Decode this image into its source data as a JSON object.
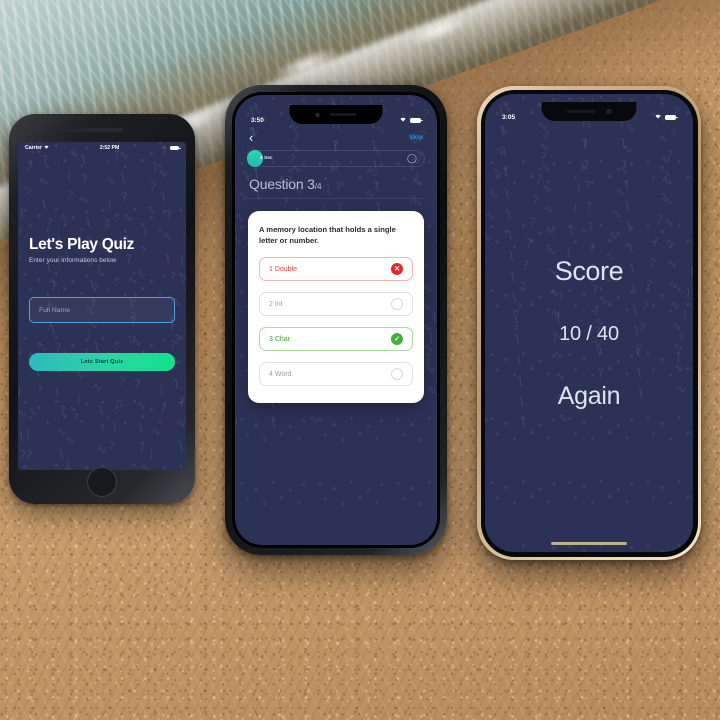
{
  "scene": {
    "background": "aerial-beach-shoreline-photo",
    "sand_color": "#c79a6b",
    "ocean_color": "#5e8580",
    "foam_color": "#eef2f2"
  },
  "theme": {
    "app_bg": "#2c3256",
    "accent_teal": "#2ed6b4",
    "accent_blue": "#2e8fe0",
    "correct_green": "#44b03a",
    "wrong_red": "#e02b2b",
    "card_white": "#ffffff",
    "text_light": "#dfe3ef"
  },
  "phone_left": {
    "device": "iphone-8-black",
    "status": {
      "carrier": "Carrier",
      "wifi_icon": "wifi-icon",
      "time": "2:52 PM",
      "battery_icon": "battery-icon"
    },
    "title": "Let's Play Quiz",
    "subtitle": "Enter your informations below",
    "name_input": {
      "value": "",
      "placeholder": "Full Name"
    },
    "start_button": "Lets Start Quiz"
  },
  "phone_middle": {
    "device": "iphone-x-black",
    "status": {
      "time": "3:50",
      "wifi_icon": "wifi-icon",
      "battery_icon": "battery-icon"
    },
    "nav": {
      "back_icon": "chevron-left-icon",
      "skip_label": "Skip"
    },
    "timer": {
      "label": "8 Sec",
      "clock_icon": "clock-icon",
      "progress_percent": 7
    },
    "question_heading": {
      "label": "Question",
      "current": "3",
      "total": "/4"
    },
    "card": {
      "question": "A memory location that holds a single letter or number.",
      "options": [
        {
          "label": "1 Double",
          "state": "wrong",
          "icon": "close-circle-icon"
        },
        {
          "label": "2 Int",
          "state": "neutral",
          "icon": "empty-circle-icon"
        },
        {
          "label": "3 Char",
          "state": "correct",
          "icon": "check-circle-icon"
        },
        {
          "label": "4 Word",
          "state": "neutral",
          "icon": "empty-circle-icon"
        }
      ]
    }
  },
  "phone_right": {
    "device": "iphone-x-gold",
    "status": {
      "time": "3:05",
      "wifi_icon": "wifi-icon",
      "battery_icon": "battery-icon"
    },
    "score_label": "Score",
    "score_value": "10 / 40",
    "again_label": "Again"
  }
}
